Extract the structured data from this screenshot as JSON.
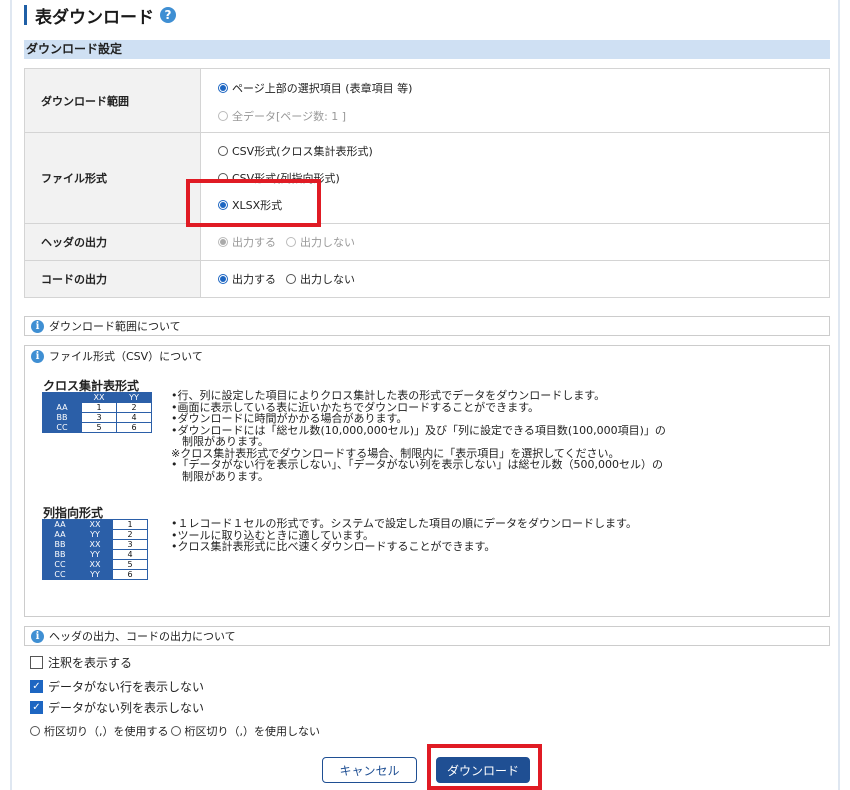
{
  "page": {
    "title": "表ダウンロード",
    "help_glyph": "?"
  },
  "settings": {
    "header": "ダウンロード設定",
    "range": {
      "label": "ダウンロード範囲",
      "options": [
        {
          "text": "ページ上部の選択項目 (表章項目 等)",
          "checked": true,
          "disabled": false
        },
        {
          "text": "全データ[ページ数: 1 ]",
          "checked": false,
          "disabled": true
        }
      ]
    },
    "format": {
      "label": "ファイル形式",
      "options": [
        {
          "text": "CSV形式(クロス集計表形式)",
          "checked": false
        },
        {
          "text": "CSV形式(列指向形式)",
          "checked": false
        },
        {
          "text": "XLSX形式",
          "checked": true
        }
      ]
    },
    "header_output": {
      "label": "ヘッダの出力",
      "yes": "出力する",
      "no": "出力しない",
      "selected": "yes",
      "disabled": true
    },
    "code_output": {
      "label": "コードの出力",
      "yes": "出力する",
      "no": "出力しない",
      "selected": "yes",
      "disabled": false
    }
  },
  "info": {
    "range_title": "ダウンロード範囲について",
    "csv_title": "ファイル形式（CSV）について",
    "output_title": "ヘッダの出力、コードの出力について",
    "icon_glyph": "i"
  },
  "cross": {
    "title": "クロス集計表形式",
    "header": [
      "",
      "XX",
      "YY"
    ],
    "rows": [
      [
        "AA",
        "1",
        "2"
      ],
      [
        "BB",
        "3",
        "4"
      ],
      [
        "CC",
        "5",
        "6"
      ]
    ],
    "lines": [
      "•行、列に設定した項目によりクロス集計した表の形式でデータをダウンロードします。",
      "•画面に表示している表に近いかたちでダウンロードすることができます。",
      "•ダウンロードに時間がかかる場合があります。",
      "•ダウンロードには「総セル数(10,000,000セル)」及び「列に設定できる項目数(100,000項目)」の",
      "　制限があります。",
      "※クロス集計表形式でダウンロードする場合、制限内に「表示項目」を選択してください。",
      "•「データがない行を表示しない」、「データがない列を表示しない」は総セル数（500,000セル）の",
      "　制限があります。"
    ]
  },
  "column": {
    "title": "列指向形式",
    "rows": [
      [
        "AA",
        "XX",
        "1"
      ],
      [
        "AA",
        "YY",
        "2"
      ],
      [
        "BB",
        "XX",
        "3"
      ],
      [
        "BB",
        "YY",
        "4"
      ],
      [
        "CC",
        "XX",
        "5"
      ],
      [
        "CC",
        "YY",
        "6"
      ]
    ],
    "lines": [
      "•１レコード１セルの形式です。システムで設定した項目の順にデータをダウンロードします。",
      "•ツールに取り込むときに適しています。",
      "•クロス集計表形式に比べ速くダウンロードすることができます。"
    ]
  },
  "options": {
    "annotation": {
      "label": "注釈を表示する",
      "checked": false
    },
    "hide_empty_rows": {
      "label": "データがない行を表示しない",
      "checked": true
    },
    "hide_empty_cols": {
      "label": "データがない列を表示しない",
      "checked": true
    },
    "separator_use": "桁区切り（,）を使用する",
    "separator_none": "桁区切り（,）を使用しない",
    "check_glyph": "✓"
  },
  "buttons": {
    "cancel": "キャンセル",
    "download": "ダウンロード"
  },
  "colors": {
    "accent": "#1f4f93",
    "highlight": "#e01b24",
    "header_bg": "#cfe0f3"
  }
}
